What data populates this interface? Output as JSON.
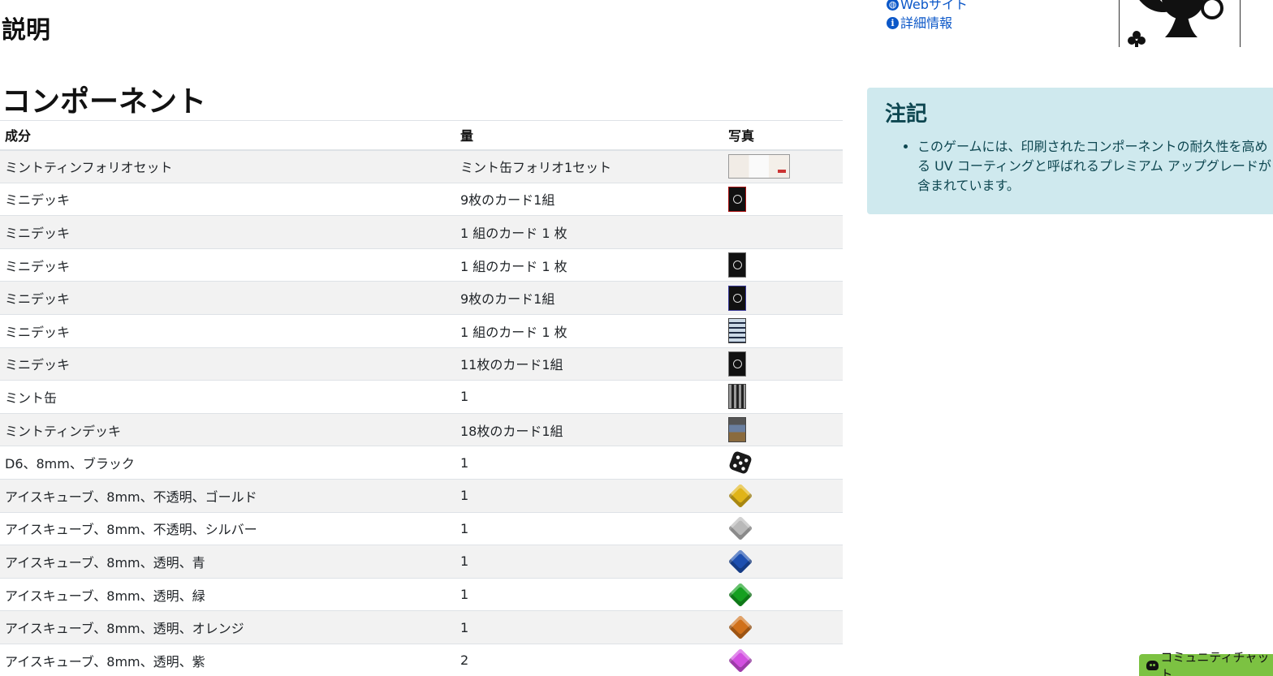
{
  "headings": {
    "description": "説明",
    "components": "コンポーネント"
  },
  "links": [
    {
      "label": "Webサイト",
      "icon": "globe-icon"
    },
    {
      "label": "詳細情報",
      "icon": "info-icon"
    }
  ],
  "table": {
    "headers": [
      "成分",
      "量",
      "写真"
    ],
    "rows": [
      {
        "name": "ミントティンフォリオセット",
        "qty": "ミント缶フォリオ1セット",
        "photo": "folio"
      },
      {
        "name": "ミニデッキ",
        "qty": "9枚のカード1組",
        "photo": "card-1"
      },
      {
        "name": "ミニデッキ",
        "qty": "1 組のカード 1 枚",
        "photo": ""
      },
      {
        "name": "ミニデッキ",
        "qty": "1 組のカード 1 枚",
        "photo": "card-2"
      },
      {
        "name": "ミニデッキ",
        "qty": "9枚のカード1組",
        "photo": "card-3"
      },
      {
        "name": "ミニデッキ",
        "qty": "1 組のカード 1 枚",
        "photo": "card-4"
      },
      {
        "name": "ミニデッキ",
        "qty": "11枚のカード1組",
        "photo": "card-5"
      },
      {
        "name": "ミント缶",
        "qty": "1",
        "photo": "card-6"
      },
      {
        "name": "ミントティンデッキ",
        "qty": "18枚のカード1組",
        "photo": "card-7"
      },
      {
        "name": "D6、8mm、ブラック",
        "qty": "1",
        "photo": "die"
      },
      {
        "name": "アイスキューブ、8mm、不透明、ゴールド",
        "qty": "1",
        "photo": "cube",
        "color": "#e0b418"
      },
      {
        "name": "アイスキューブ、8mm、不透明、シルバー",
        "qty": "1",
        "photo": "cube",
        "color": "#b9b9b9"
      },
      {
        "name": "アイスキューブ、8mm、透明、青",
        "qty": "1",
        "photo": "cube",
        "color": "#1d4fb0"
      },
      {
        "name": "アイスキューブ、8mm、透明、緑",
        "qty": "1",
        "photo": "cube",
        "color": "#15a020"
      },
      {
        "name": "アイスキューブ、8mm、透明、オレンジ",
        "qty": "1",
        "photo": "cube",
        "color": "#d0701a"
      },
      {
        "name": "アイスキューブ、8mm、透明、紫",
        "qty": "2",
        "photo": "cube",
        "color": "#d24fe0"
      }
    ]
  },
  "note": {
    "title": "注記",
    "items": [
      "このゲームには、印刷されたコンポーネントの耐久性を高める UV コーティングと呼ばれるプレミアム アップグレードが含まれています。"
    ]
  },
  "chat": {
    "label": "コミュニティチャット",
    "icon": "discord-icon"
  },
  "colors": {
    "link": "#0b57c8",
    "note_bg": "#cfe9ee",
    "chat_bg": "#7cc242"
  }
}
